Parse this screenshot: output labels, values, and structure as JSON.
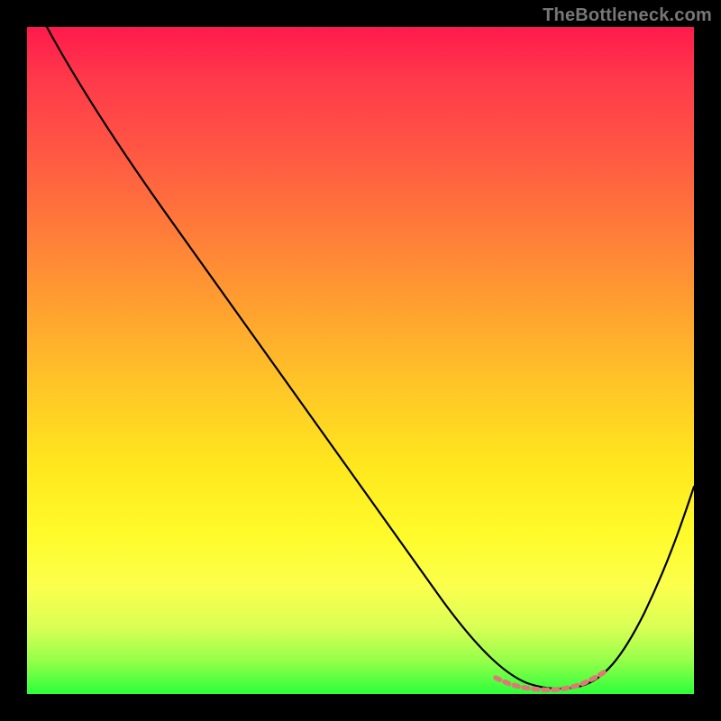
{
  "watermark": "TheBottleneck.com",
  "chart_data": {
    "type": "line",
    "title": "",
    "xlabel": "",
    "ylabel": "",
    "xlim": [
      0,
      100
    ],
    "ylim": [
      0,
      100
    ],
    "grid": false,
    "legend": false,
    "x": [
      3,
      10,
      18,
      26,
      34,
      42,
      50,
      58,
      62,
      66,
      70,
      74,
      78,
      80,
      82,
      85,
      89,
      93,
      96,
      100
    ],
    "values": [
      100,
      93,
      83,
      72,
      61,
      50,
      39,
      27,
      21,
      15,
      9,
      4,
      2,
      1,
      1,
      2,
      8,
      18,
      28,
      40
    ],
    "annotation_region": {
      "x_start": 70,
      "x_end": 86,
      "y": 2,
      "color": "#d96a6a"
    },
    "gradient_stops": [
      {
        "pos": 0,
        "color": "#ff1a4d"
      },
      {
        "pos": 18,
        "color": "#ff5544"
      },
      {
        "pos": 42,
        "color": "#ffa030"
      },
      {
        "pos": 66,
        "color": "#ffe81e"
      },
      {
        "pos": 90,
        "color": "#d9ff55"
      },
      {
        "pos": 100,
        "color": "#2bff3a"
      }
    ]
  }
}
